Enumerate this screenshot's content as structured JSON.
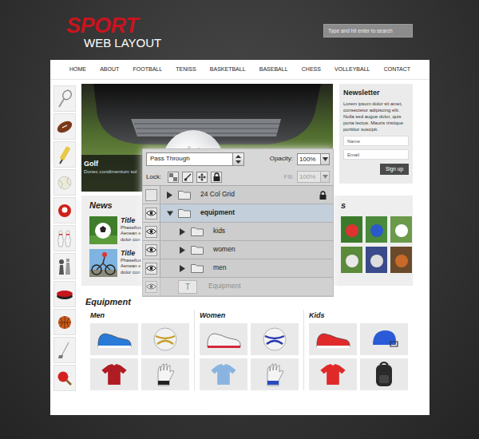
{
  "logo": {
    "title": "SPORT",
    "subtitle": "WEB LAYOUT"
  },
  "search": {
    "placeholder": "Type and hit enter to search"
  },
  "nav": [
    "HOME",
    "ABOUT",
    "FOOTBALL",
    "TENISS",
    "BASKETBALL",
    "BASEBALL",
    "CHESS",
    "VOLLEYBALL",
    "CONTACT"
  ],
  "hero": {
    "title": "Golf",
    "text": "Donec condimentum sol"
  },
  "newsletter": {
    "title": "Newsletter",
    "text": "Lorem ipsum dolor sit amet, consectetur adipiscing elit. Nulla sed augue dolor, quis porta lectus. Mauris tristique porttitor suscipit.",
    "fields": [
      {
        "placeholder": "Name"
      },
      {
        "placeholder": "Email"
      }
    ],
    "button": "Sign up"
  },
  "news": {
    "title": "News",
    "items": [
      {
        "title": "Title",
        "lines": [
          "Phasellus",
          "Aenean e",
          "dolor con"
        ]
      },
      {
        "title": "Title",
        "lines": [
          "Phasellus",
          "Aenean e",
          "dolor con"
        ]
      }
    ]
  },
  "gallery": {
    "title": "s"
  },
  "equipment": {
    "title": "Equipment",
    "groups": [
      {
        "title": "Men"
      },
      {
        "title": "Women"
      },
      {
        "title": "Kids"
      }
    ]
  },
  "layers_panel": {
    "blend_mode": "Pass Through",
    "opacity_label": "Opacity:",
    "opacity": "100%",
    "lock_label": "Lock:",
    "fill_label": "Fill:",
    "fill": "100%",
    "fill_disabled": true,
    "layers": [
      {
        "name": "24 Col Grid",
        "kind": "group",
        "visible": false,
        "expanded": false,
        "locked": true,
        "selected": false
      },
      {
        "name": "equipment",
        "kind": "group",
        "visible": true,
        "expanded": true,
        "locked": false,
        "selected": true,
        "children": [
          {
            "name": "kids",
            "kind": "group",
            "visible": true,
            "expanded": false,
            "locked": false,
            "selected": false
          },
          {
            "name": "women",
            "kind": "group",
            "visible": true,
            "expanded": false,
            "locked": false,
            "selected": false
          },
          {
            "name": "men",
            "kind": "group",
            "visible": true,
            "expanded": false,
            "locked": false,
            "selected": false
          }
        ]
      },
      {
        "name": "Equipment",
        "kind": "text",
        "icon": "T",
        "visible": true,
        "locked": false,
        "selected": false
      }
    ]
  }
}
